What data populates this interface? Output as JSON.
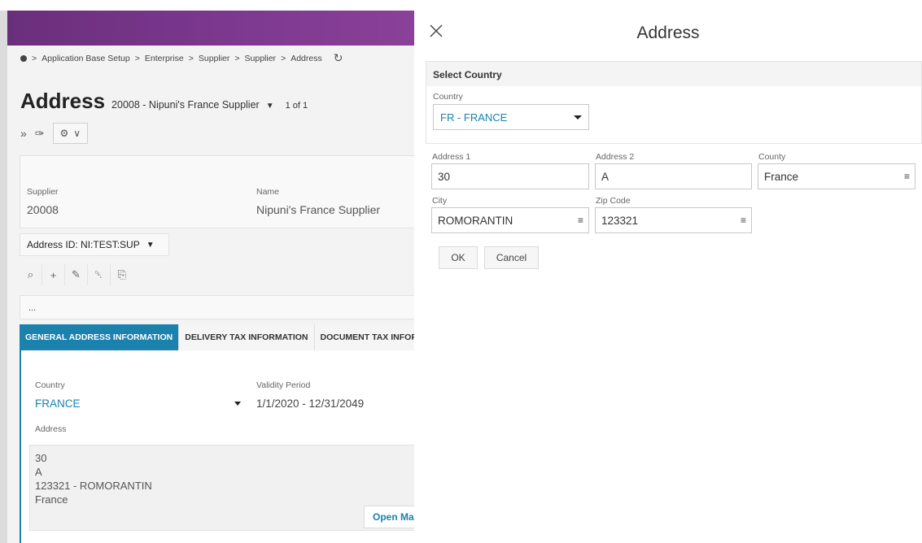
{
  "background_page": {
    "breadcrumb": [
      "Application Base Setup",
      "Enterprise",
      "Supplier",
      "Supplier",
      "Address"
    ],
    "title": "Address",
    "subtitle": "20008 - Nipuni's France Supplier",
    "record_count": "1 of 1",
    "supplier_label": "Supplier",
    "supplier_value": "20008",
    "name_label": "Name",
    "name_value": "Nipuni's France Supplier",
    "address_id": "Address ID: NI:TEST:SUP",
    "dots": "...",
    "tabs": [
      "GENERAL ADDRESS INFORMATION",
      "DELIVERY TAX INFORMATION",
      "DOCUMENT TAX INFORMAT"
    ],
    "country_label": "Country",
    "country_value": "FRANCE",
    "validity_label": "Validity Period",
    "validity_value": "1/1/2020 - 12/31/2049",
    "address_label": "Address",
    "address_lines": [
      "30",
      "A",
      "123321 - ROMORANTIN",
      "France"
    ],
    "open_map": "Open Map"
  },
  "dialog": {
    "title": "Address",
    "select_country_header": "Select Country",
    "country_label": "Country",
    "country_value": "FR - FRANCE",
    "address1_label": "Address 1",
    "address1_value": "30",
    "address2_label": "Address 2",
    "address2_value": "A",
    "county_label": "County",
    "county_value": "France",
    "city_label": "City",
    "city_value": "ROMORANTIN",
    "zip_label": "Zip Code",
    "zip_value": "123321",
    "ok_label": "OK",
    "cancel_label": "Cancel"
  },
  "colors": {
    "accent": "#1a82ad",
    "header_purple": "#7e3990"
  },
  "icons": [
    "close-icon",
    "lov-icon",
    "refresh-icon",
    "search-icon",
    "add-icon",
    "edit-icon",
    "delete-icon",
    "duplicate-icon",
    "attachment-icon",
    "expand-icon"
  ]
}
